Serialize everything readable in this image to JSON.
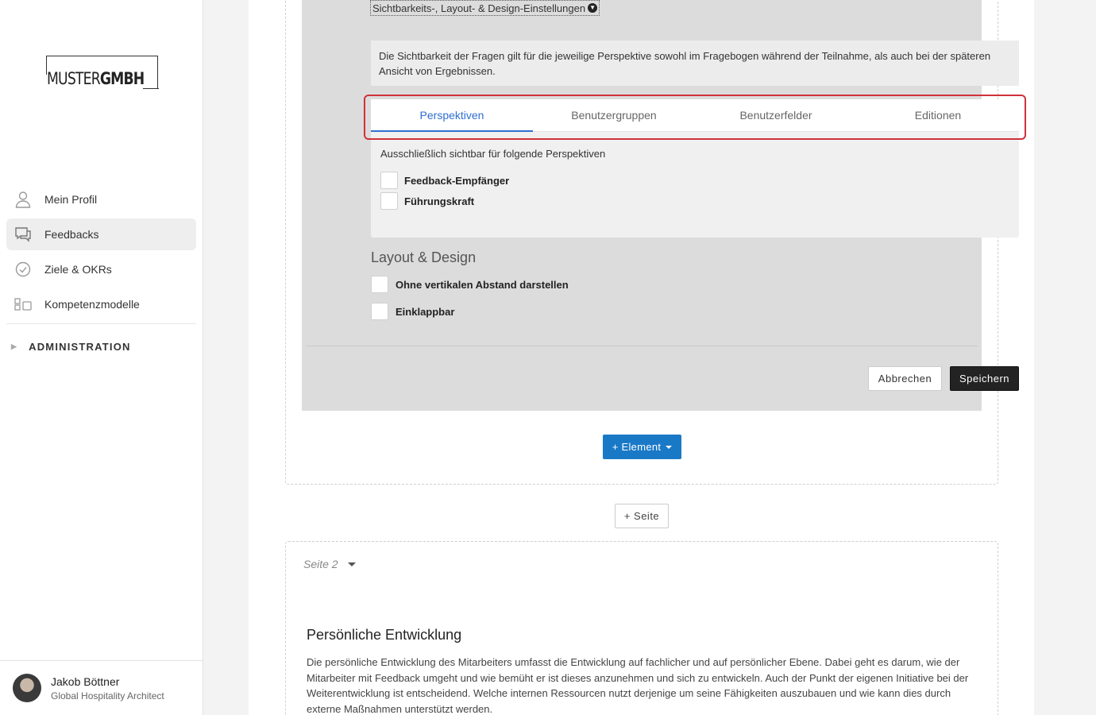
{
  "brand": {
    "logo_light": "MUSTER",
    "logo_bold": "GMBH"
  },
  "sidebar": {
    "items": [
      {
        "label": "Mein Profil",
        "icon": "person-icon",
        "active": false
      },
      {
        "label": "Feedbacks",
        "icon": "chat-bubbles-icon",
        "active": true
      },
      {
        "label": "Ziele & OKRs",
        "icon": "check-circle-icon",
        "active": false
      },
      {
        "label": "Kompetenzmodelle",
        "icon": "blocks-icon",
        "active": false
      }
    ],
    "admin_label": "ADMINISTRATION"
  },
  "user": {
    "name": "Jakob Böttner",
    "role": "Global Hospitality Architect"
  },
  "settings": {
    "toggle_label": "Sichtbarkeits-, Layout- & Design-Einstellungen",
    "info_text": "Die Sichtbarkeit der Fragen gilt für die jeweilige Perspektive sowohl im Fragebogen während der Teilnahme, als auch bei der späteren Ansicht von Ergebnissen.",
    "tabs": [
      {
        "label": "Perspektiven",
        "active": true
      },
      {
        "label": "Benutzergruppen",
        "active": false
      },
      {
        "label": "Benutzerfelder",
        "active": false
      },
      {
        "label": "Editionen",
        "active": false
      }
    ],
    "perspectives_heading": "Ausschließlich sichtbar für folgende Perspektiven",
    "perspectives": [
      {
        "label": "Feedback-Empfänger",
        "checked": false
      },
      {
        "label": "Führungskraft",
        "checked": false
      }
    ],
    "layout_title": "Layout & Design",
    "layout_options": [
      {
        "label": "Ohne vertikalen Abstand darstellen",
        "checked": false
      },
      {
        "label": "Einklappbar",
        "checked": false
      }
    ],
    "cancel_label": "Abbrechen",
    "save_label": "Speichern"
  },
  "add_element_label": "+ Element",
  "add_page_label": "+ Seite",
  "page2": {
    "label": "Seite 2",
    "section_title": "Persönliche Entwicklung",
    "section_text": "Die persönliche Entwicklung des Mitarbeiters umfasst die Entwicklung auf fachlicher und auf persönlicher Ebene. Dabei geht es darum, wie der Mitarbeiter mit Feedback umgeht und wie bemüht er ist dieses anzunehmen und sich zu entwickeln. Auch der Punkt der eigenen Initiative bei der Weiterentwicklung ist entscheidend. Welche internen Ressourcen nutzt derjenige um seine Fähigkeiten auszubauen und wie kann dies durch externe Maßnahmen unterstützt werden."
  },
  "colors": {
    "accent_blue": "#2e6fd0",
    "button_blue": "#1a79c7",
    "highlight_red": "#d0313a",
    "dark_button": "#232323"
  }
}
